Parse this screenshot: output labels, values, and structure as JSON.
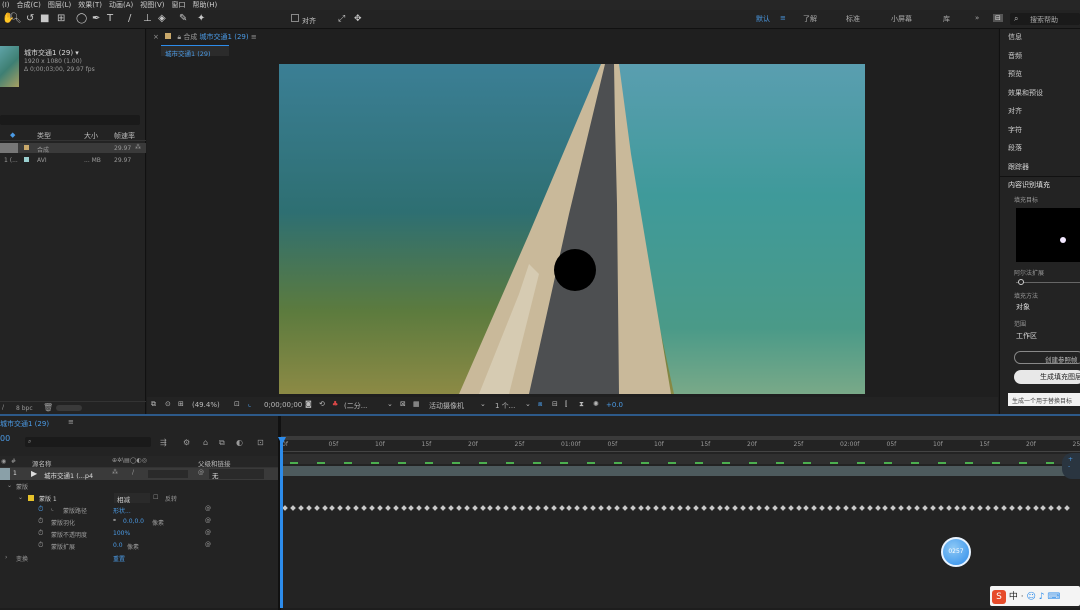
{
  "menu": [
    "(I)",
    "合成(C)",
    "图层(L)",
    "效果(T)",
    "动画(A)",
    "视图(V)",
    "窗口",
    "帮助(H)"
  ],
  "toolbar": {
    "align_label": "对齐",
    "workspaces": [
      "默认",
      "了解",
      "标准",
      "小屏幕",
      "库"
    ],
    "search_placeholder": "搜索帮助"
  },
  "project": {
    "name": "城市交通1 (29) ▾",
    "resolution": "1920 x 1080 (1.00)",
    "duration": "Δ 0;00;03;00, 29.97 fps",
    "columns": {
      "type": "类型",
      "size": "大小",
      "fps": "帧速率"
    },
    "rows": [
      {
        "type": "合成",
        "size": "",
        "fps": "29.97"
      },
      {
        "type": "AVI",
        "size": "... MB",
        "fps": "29.97"
      }
    ],
    "bpc": "8 bpc"
  },
  "comp": {
    "breadcrumb_prefix": "合成",
    "comp_name": "城市交通1 (29)",
    "tab": "城市交通1 (29)",
    "viewer": {
      "zoom": "(49.4%)",
      "timecode": "0;00;00;00",
      "quality": "(二分...",
      "camera": "活动摄像机",
      "views": "1 个...",
      "exposure": "+0.0"
    }
  },
  "right": {
    "panels": [
      "信息",
      "音频",
      "预览",
      "效果和预设",
      "对齐",
      "字符",
      "段落",
      "跟踪器"
    ],
    "fill": {
      "title": "内容识别填充",
      "target": "填充目标",
      "alpha_expand": "阿尔法扩展",
      "method_label": "填充方法",
      "method": "对象",
      "range_label": "范围",
      "range": "工作区",
      "create_btn": "创建参照帧",
      "generate_btn": "生成填充图层",
      "hint": "生成一个用于替换目标"
    }
  },
  "timeline": {
    "tab": "城市交通1 (29)",
    "timecode": "00",
    "cols": {
      "layer": "源名称",
      "parent": "父级和链接"
    },
    "layer": {
      "num": "1",
      "name": "城市交通1 (...p4",
      "parent": "无"
    },
    "mask_group": "蒙版",
    "mask": "蒙版 1",
    "mask_mode": "相减",
    "invert": "反转",
    "props": [
      {
        "name": "蒙版路径",
        "value": "形状..."
      },
      {
        "name": "蒙版羽化",
        "value": "0.0,0.0",
        "unit": "像素"
      },
      {
        "name": "蒙版不透明度",
        "value": "100%"
      },
      {
        "name": "蒙版扩展",
        "value": "0.0",
        "unit": "像素"
      }
    ],
    "transform": "变换",
    "reset": "重置",
    "ruler": [
      "0f",
      "05f",
      "10f",
      "15f",
      "20f",
      "25f",
      "01:00f",
      "05f",
      "10f",
      "15f",
      "20f",
      "25f",
      "02:00f",
      "05f",
      "10f",
      "15f",
      "20f",
      "25f"
    ],
    "badge": "0257"
  },
  "taskbar": {
    "ime": "中"
  },
  "colors": {
    "accent": "#2d8ceb",
    "bg": "#1d1d1d"
  }
}
